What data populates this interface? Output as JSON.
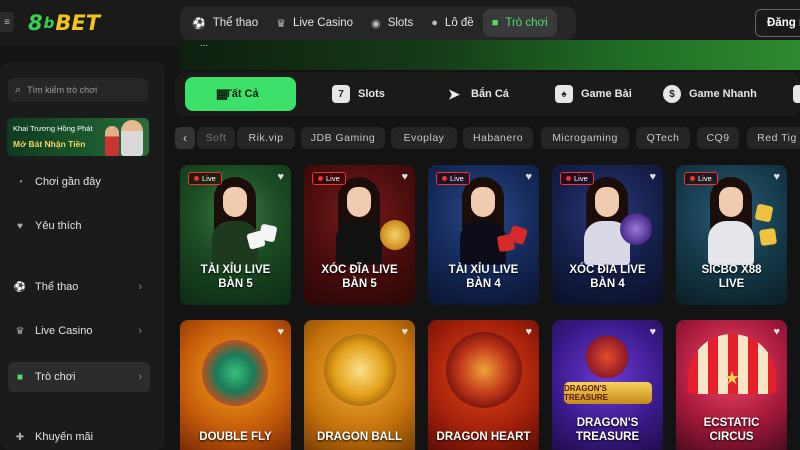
{
  "header": {
    "logo_num": "8",
    "logo_text": "BET",
    "logo_full": "8bBET",
    "nav": [
      {
        "label": "Thể thao",
        "icon": "soccer-ball-icon"
      },
      {
        "label": "Live Casino",
        "icon": "casino-chip-icon"
      },
      {
        "label": "Slots",
        "icon": "eye-icon"
      },
      {
        "label": "Lô đề",
        "icon": "lottery-balls-icon"
      },
      {
        "label": "Trò chơi",
        "icon": "gamepad-icon",
        "active": true
      }
    ],
    "login_label": "Đăng n"
  },
  "banner": {
    "text": "..."
  },
  "sidebar": {
    "search_placeholder": "Tìm kiếm trò chơi",
    "promo": {
      "line1": "Khai Trương Hồng Phát",
      "line2": "Mở Bát Nhận Tiền"
    },
    "items": [
      {
        "label": "Chơi gần đây",
        "icon": "clock-icon",
        "chevron": false
      },
      {
        "label": "Yêu thích",
        "icon": "heart-icon",
        "chevron": false
      },
      {
        "label": "Thể thao",
        "icon": "soccer-ball-icon",
        "chevron": true
      },
      {
        "label": "Live Casino",
        "icon": "casino-chip-icon",
        "chevron": true
      },
      {
        "label": "Trò chơi",
        "icon": "gamepad-icon",
        "chevron": true,
        "active": true
      },
      {
        "label": "Khuyến mãi",
        "icon": "gift-icon",
        "chevron": false
      }
    ]
  },
  "categories": [
    {
      "label": "Tất Cả",
      "icon": "grid-icon",
      "active": true
    },
    {
      "label": "Slots",
      "icon": "slot-seven-icon"
    },
    {
      "label": "Bắn Cá",
      "icon": "fish-icon"
    },
    {
      "label": "Game Bài",
      "icon": "cards-icon"
    },
    {
      "label": "Game Nhanh",
      "icon": "stopwatch-icon"
    }
  ],
  "providers": [
    "Soft",
    "Rik.vip",
    "JDB Gaming",
    "Evoplay",
    "Habanero",
    "Microgaming",
    "QTech",
    "CQ9",
    "Red Tig"
  ],
  "live_badge": "Live",
  "games_row1": [
    {
      "line1": "TÀI XỈU LIVE",
      "line2": "BÀN 5"
    },
    {
      "line1": "XÓC ĐĨA LIVE",
      "line2": "BÀN 5"
    },
    {
      "line1": "TÀI XỈU LIVE",
      "line2": "BÀN 4"
    },
    {
      "line1": "XÓC ĐĨA LIVE",
      "line2": "BÀN 4"
    },
    {
      "line1": "SICBO X88",
      "line2": "LIVE"
    }
  ],
  "games_row2": [
    {
      "line1": "",
      "line2": "DOUBLE FLY"
    },
    {
      "line1": "",
      "line2": "DRAGON BALL"
    },
    {
      "line1": "",
      "line2": "DRAGON HEART"
    },
    {
      "line1": "DRAGON'S",
      "line2": "TREASURE"
    },
    {
      "line1": "ECSTATIC",
      "line2": "CIRCUS"
    }
  ],
  "art_labels": {
    "dragons_logo": "DRAGON'S TREASURE"
  },
  "colors": {
    "accent": "#3de068",
    "gold": "#f4c31c",
    "live_red": "#e33333",
    "bg": "#131313"
  }
}
